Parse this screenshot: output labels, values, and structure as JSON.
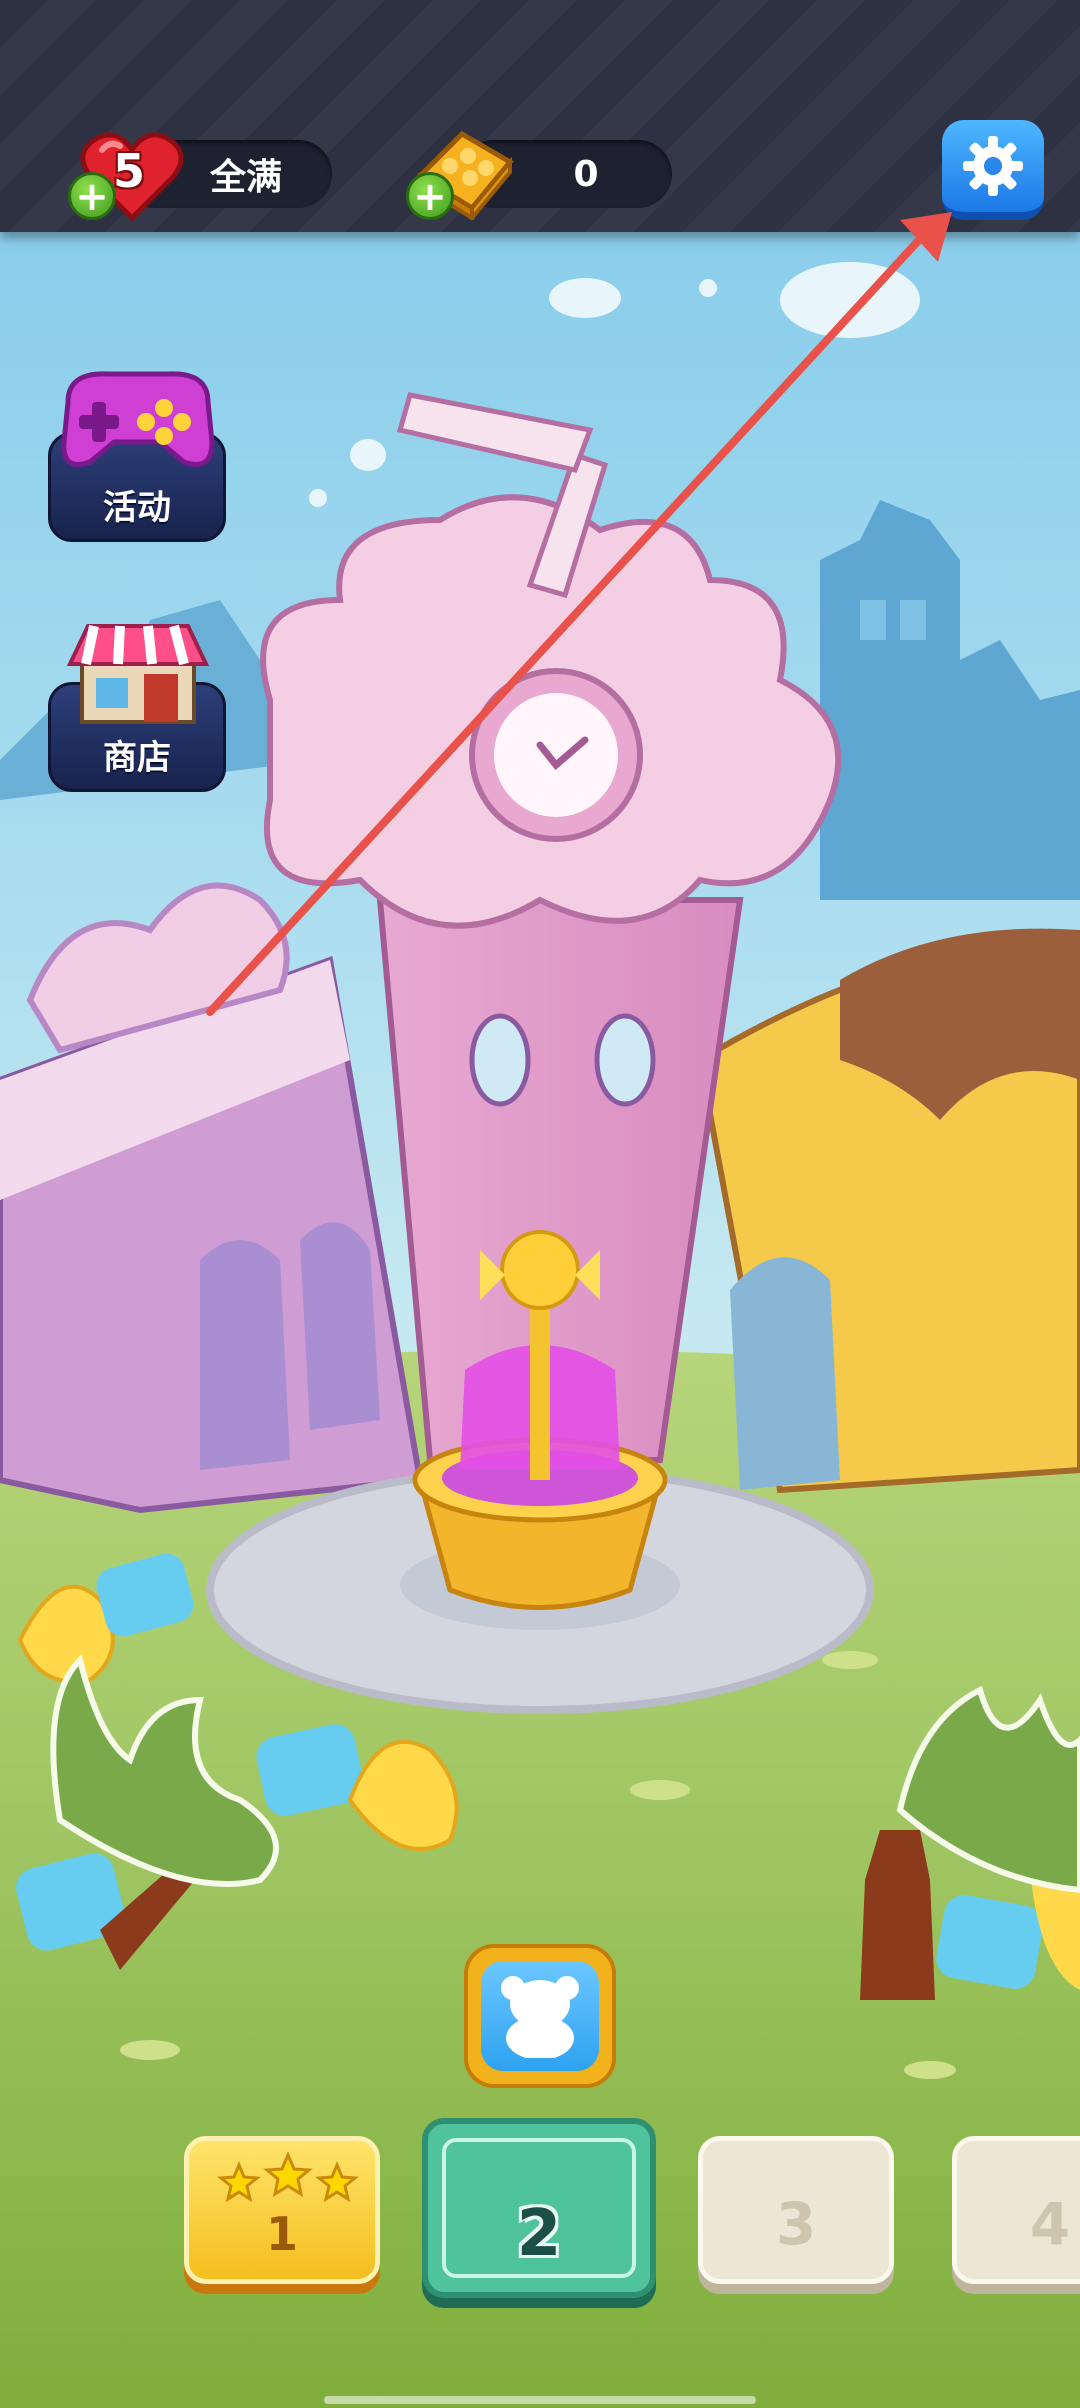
{
  "hud": {
    "lives": {
      "count": "5",
      "status": "全满",
      "icon": "heart-icon",
      "add_icon": "plus-icon"
    },
    "gold": {
      "amount": "0",
      "icon": "gold-bar-icon",
      "add_icon": "plus-icon"
    },
    "settings_icon": "gear-icon"
  },
  "side_menu": {
    "events": {
      "label": "活动",
      "icon": "gamepad-icon"
    },
    "shop": {
      "label": "商店",
      "icon": "shop-icon"
    }
  },
  "bottom": {
    "unlock_icon": "bear-silhouette-icon",
    "levels": [
      {
        "label": "1",
        "state": "completed",
        "stars": 3
      },
      {
        "label": "2",
        "state": "current"
      },
      {
        "label": "3",
        "state": "locked"
      },
      {
        "label": "4",
        "state": "locked"
      }
    ]
  },
  "annotation": {
    "type": "arrow",
    "color": "#e8524a",
    "points_to": "settings-button"
  },
  "colors": {
    "hud_bg": "#2e3142",
    "settings_blue": "#1b78e6",
    "current_level_green": "#4fc39c",
    "gold": "#f4bf1f"
  }
}
